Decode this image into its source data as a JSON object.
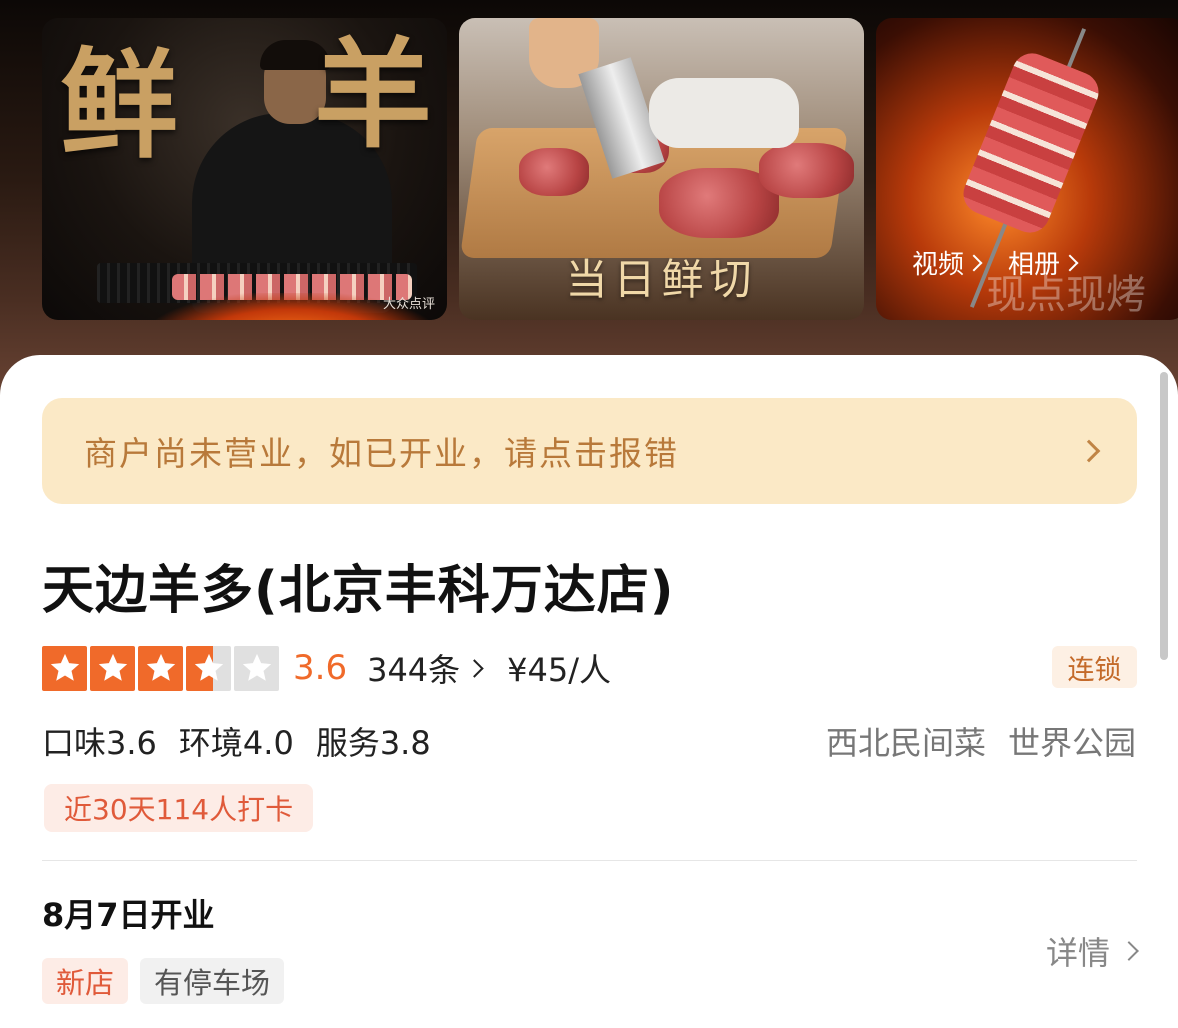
{
  "gallery": {
    "photo1_chars": [
      "鲜",
      "羊"
    ],
    "photo1_watermark": "大众点评",
    "photo2_caption": "当日鲜切",
    "photo3_caption": "现点现烤",
    "video_label": "视频",
    "album_label": "相册"
  },
  "notice": {
    "text": "商户尚未营业，如已开业，请点击报错"
  },
  "shop": {
    "name": "天边羊多(北京丰科万达店)",
    "rating_value": 3.6,
    "rating_text": "3.6",
    "reviews": "344条",
    "price": "¥45/人",
    "chain_tag": "连锁",
    "sub_scores": [
      "口味3.6",
      "环境4.0",
      "服务3.8"
    ],
    "categories": [
      "西北民间菜",
      "世界公园"
    ],
    "checkin": "近30天114人打卡",
    "open_date": "8月7日开业",
    "detail_link": "详情",
    "tags": [
      "新店",
      "有停车场"
    ]
  },
  "colors": {
    "star_active": "#f06a2a",
    "star_inactive": "#e0e0e0",
    "notice_bg": "#fbe9c6",
    "notice_text": "#b8793a"
  },
  "icons": {
    "star": "star-icon",
    "chevron": "chevron-right-icon"
  }
}
